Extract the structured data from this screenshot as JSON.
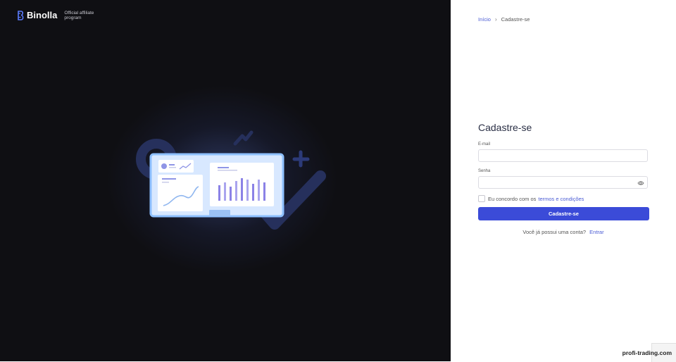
{
  "brand": {
    "name": "Binolla",
    "subtitle": "Official affiliate program",
    "logo_icon": "binolla-logo-icon"
  },
  "breadcrumb": {
    "home": "Início",
    "current": "Cadastre-se"
  },
  "form": {
    "title": "Cadastre-se",
    "email_label": "E-mail",
    "email_value": "",
    "password_label": "Senha",
    "password_value": "",
    "agree_text": "Eu concordo com os",
    "terms_link": "termos e condições",
    "submit_label": "Cadastre-se",
    "have_account": "Você já possui uma conta?",
    "login_link": "Entrar"
  },
  "watermark": "profi-trading.com",
  "colors": {
    "accent": "#3b4bd8",
    "left_bg": "#0f0f13",
    "link": "#4a5bd4"
  }
}
